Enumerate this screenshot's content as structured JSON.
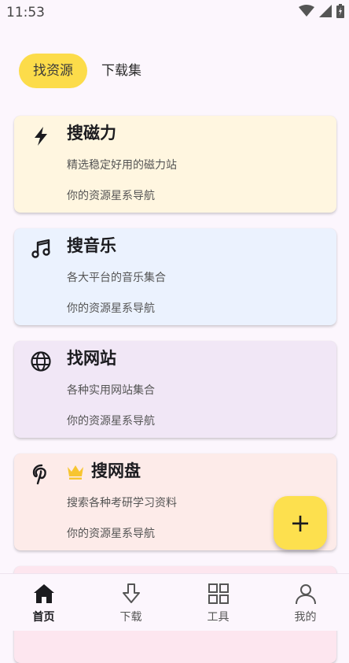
{
  "status_bar": {
    "time": "11:53"
  },
  "top_tabs": [
    {
      "label": "找资源",
      "active": true
    },
    {
      "label": "下载集",
      "active": false
    }
  ],
  "cards": [
    {
      "title": "搜磁力",
      "subtitle": "精选稳定好用的磁力站",
      "tagline": "你的资源星系导航",
      "icon": "bolt-icon",
      "bg": "#fff6e0"
    },
    {
      "title": "搜音乐",
      "subtitle": "各大平台的音乐集合",
      "tagline": "你的资源星系导航",
      "icon": "music-note-icon",
      "bg": "#ebf2fe"
    },
    {
      "title": "找网站",
      "subtitle": "各种实用网站集合",
      "tagline": "你的资源星系导航",
      "icon": "globe-icon",
      "bg": "#f1e7f6"
    },
    {
      "title": "搜网盘",
      "subtitle": "搜索各种考研学习资料",
      "tagline": "你的资源星系导航",
      "icon": "pinterest-icon",
      "badge": "crown-icon",
      "bg": "#fdebe9"
    },
    {
      "title": "",
      "subtitle": "",
      "tagline": "",
      "bg": "#fde6ef"
    }
  ],
  "fab": {
    "label": "+"
  },
  "bottom_nav": [
    {
      "label": "首页",
      "icon": "home-icon",
      "active": true
    },
    {
      "label": "下载",
      "icon": "download-icon",
      "active": false
    },
    {
      "label": "工具",
      "icon": "grid-icon",
      "active": false
    },
    {
      "label": "我的",
      "icon": "person-icon",
      "active": false
    }
  ],
  "colors": {
    "accent": "#fcdc4a",
    "fab": "#fde04e",
    "crown": "#f7c531",
    "background": "#fcf6fd"
  }
}
